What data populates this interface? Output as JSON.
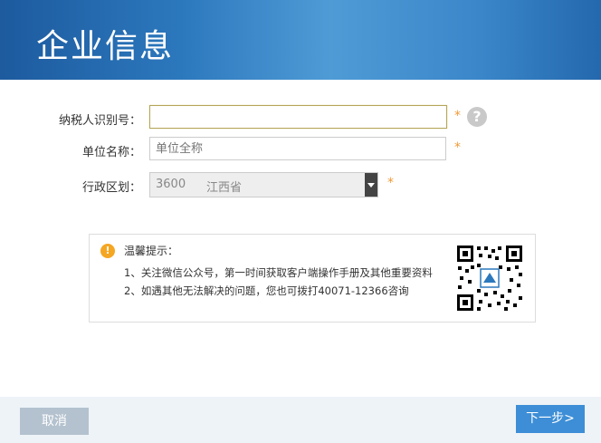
{
  "header": {
    "title": "企业信息"
  },
  "form": {
    "taxpayer_id": {
      "label": "纳税人识别号：",
      "value": "",
      "placeholder": "",
      "required_mark": "*",
      "help": "?"
    },
    "unit_name": {
      "label": "单位名称：",
      "value": "",
      "placeholder": "单位全称",
      "required_mark": "*"
    },
    "region": {
      "label": "行政区划：",
      "code": "3600",
      "province": "江西省",
      "required_mark": "*"
    }
  },
  "notice": {
    "icon": "!",
    "title": "温馨提示：",
    "lines": [
      "1、关注微信公众号，第一时间获取客户端操作手册及其他重要资料",
      "2、如遇其他无法解决的问题，您也可拨打40071-12366咨询"
    ]
  },
  "footer": {
    "cancel_label": "取消",
    "next_label": "下一步>"
  },
  "colors": {
    "header_blue": "#2c78bd",
    "accent_orange": "#f09a36",
    "next_button": "#3d8ed6",
    "cancel_button": "#b4c2cf"
  }
}
